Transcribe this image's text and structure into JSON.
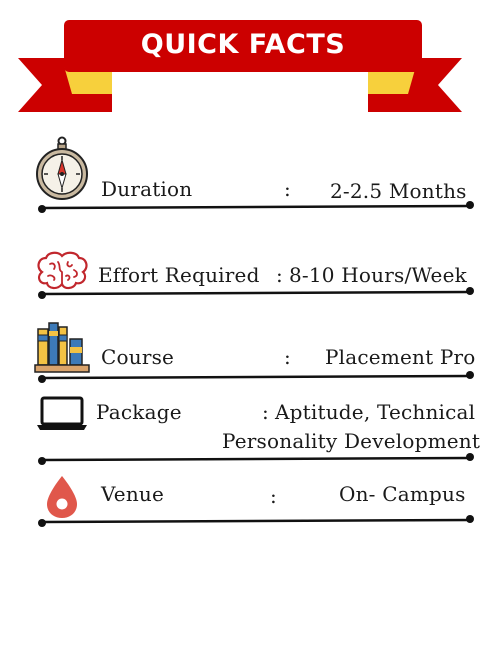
{
  "title": "QUICK FACTS",
  "colors": {
    "banner_red": "#cc0000",
    "ribbon_yellow": "#f7d03c",
    "text": "#1a1a1a"
  },
  "facts": [
    {
      "label": "Duration",
      "colon": ":",
      "value": "2-2.5 Months",
      "icon": "compass-icon"
    },
    {
      "label": "Effort Required",
      "colon": ":",
      "value": "8-10 Hours/Week",
      "icon": "brain-icon"
    },
    {
      "label": "Course",
      "colon": ":",
      "value": "Placement Pro",
      "icon": "books-icon"
    },
    {
      "label": "Package",
      "colon": ":",
      "value": "Aptitude, Technical",
      "value_line2": "Personality Development",
      "icon": "laptop-icon"
    },
    {
      "label": "Venue",
      "colon": ":",
      "value": "On- Campus",
      "icon": "location-drop-icon"
    }
  ]
}
